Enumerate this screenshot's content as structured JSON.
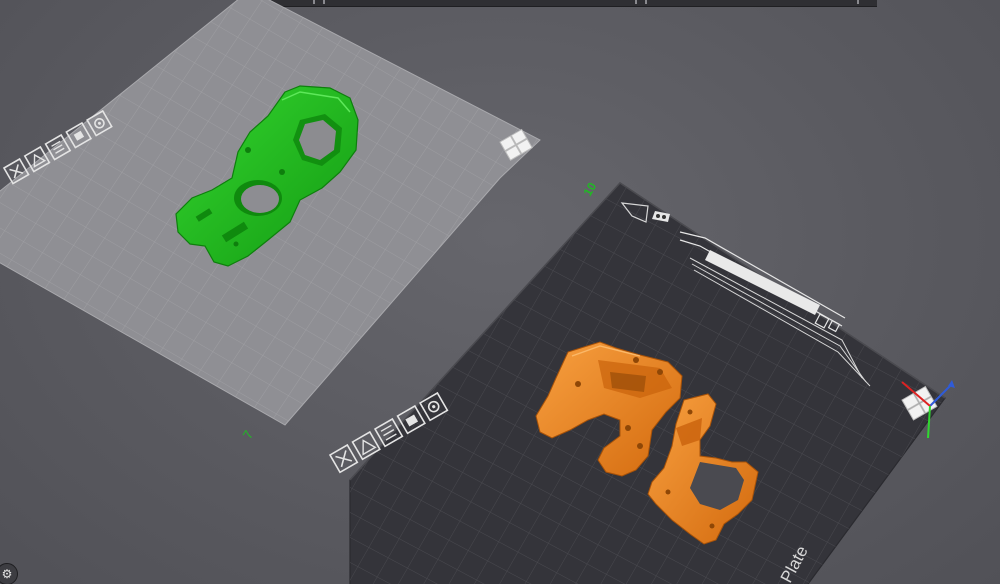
{
  "app": {
    "colors": {
      "background": "#5b5b61",
      "plate_light": "#8d8d92",
      "plate_dark": "#333338",
      "part_green": "#22c21e",
      "part_orange": "#f0861c",
      "plate_number_color": "#21b825"
    }
  },
  "plates": [
    {
      "id": "plate-1",
      "number": "7",
      "style": "light",
      "tools": [
        "close-icon",
        "auto-orient-icon",
        "arrange-icon",
        "lock-icon",
        "settings-icon"
      ],
      "objects": [
        {
          "name": "green-part",
          "color": "#22c21e"
        }
      ]
    },
    {
      "id": "plate-2",
      "number": "10",
      "style": "dark",
      "watermark": "Plate",
      "tools": [
        "close-icon",
        "auto-orient-icon",
        "arrange-icon",
        "lock-icon",
        "settings-icon"
      ],
      "objects": [
        {
          "name": "orange-part-left",
          "color": "#f0861c"
        },
        {
          "name": "orange-part-right",
          "color": "#f0861c"
        }
      ]
    }
  ],
  "corner_tool": {
    "icon": "gear-icon",
    "glyph": "⚙"
  }
}
